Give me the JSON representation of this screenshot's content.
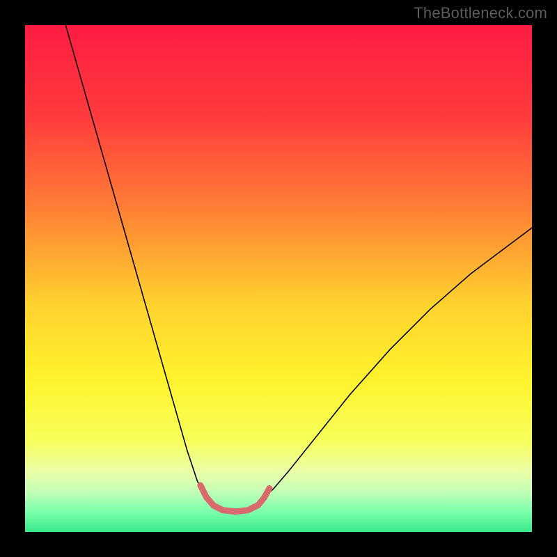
{
  "watermark": "TheBottleneck.com",
  "chart_data": {
    "type": "line",
    "title": "",
    "xlabel": "",
    "ylabel": "",
    "xlim": [
      0,
      100
    ],
    "ylim": [
      0,
      100
    ],
    "gradient_stops": [
      {
        "offset": 0,
        "color": "#ff1c42"
      },
      {
        "offset": 18,
        "color": "#ff3b3d"
      },
      {
        "offset": 35,
        "color": "#ff7a36"
      },
      {
        "offset": 55,
        "color": "#ffd22e"
      },
      {
        "offset": 70,
        "color": "#fff32e"
      },
      {
        "offset": 82,
        "color": "#f6ff5a"
      },
      {
        "offset": 88,
        "color": "#ecffa7"
      },
      {
        "offset": 92,
        "color": "#c4ffb6"
      },
      {
        "offset": 96,
        "color": "#7cffad"
      },
      {
        "offset": 100,
        "color": "#37e989"
      }
    ],
    "series": [
      {
        "name": "left-arm",
        "color": "#000000",
        "width": 1.6,
        "x": [
          8,
          10,
          12,
          14,
          16,
          18,
          20,
          22,
          24,
          26,
          28,
          30,
          32,
          34,
          35.8
        ],
        "y": [
          100,
          93,
          86,
          79,
          72,
          65,
          58,
          51,
          44,
          37,
          30,
          23,
          16,
          10,
          6.8
        ]
      },
      {
        "name": "right-arm",
        "color": "#000000",
        "width": 1.6,
        "x": [
          47.2,
          49,
          52,
          56,
          60,
          64,
          68,
          72,
          76,
          80,
          84,
          88,
          92,
          96,
          100
        ],
        "y": [
          6.8,
          8.5,
          12,
          17,
          22,
          27,
          31.5,
          36,
          40,
          44,
          47.5,
          51,
          54,
          57,
          60
        ]
      },
      {
        "name": "valley-highlight",
        "color": "#d96b6f",
        "width": 9,
        "linecap": "round",
        "x": [
          34.6,
          35.8,
          37.2,
          39,
          41.5,
          44,
          46,
          47.2,
          48.2
        ],
        "y": [
          9.2,
          6.8,
          5.2,
          4.3,
          4.0,
          4.3,
          5.3,
          6.8,
          8.6
        ]
      }
    ],
    "note": "Axis values are percentages of the plot area (0 at left/bottom). Curve min ≈ (41.5, 4.0)."
  }
}
